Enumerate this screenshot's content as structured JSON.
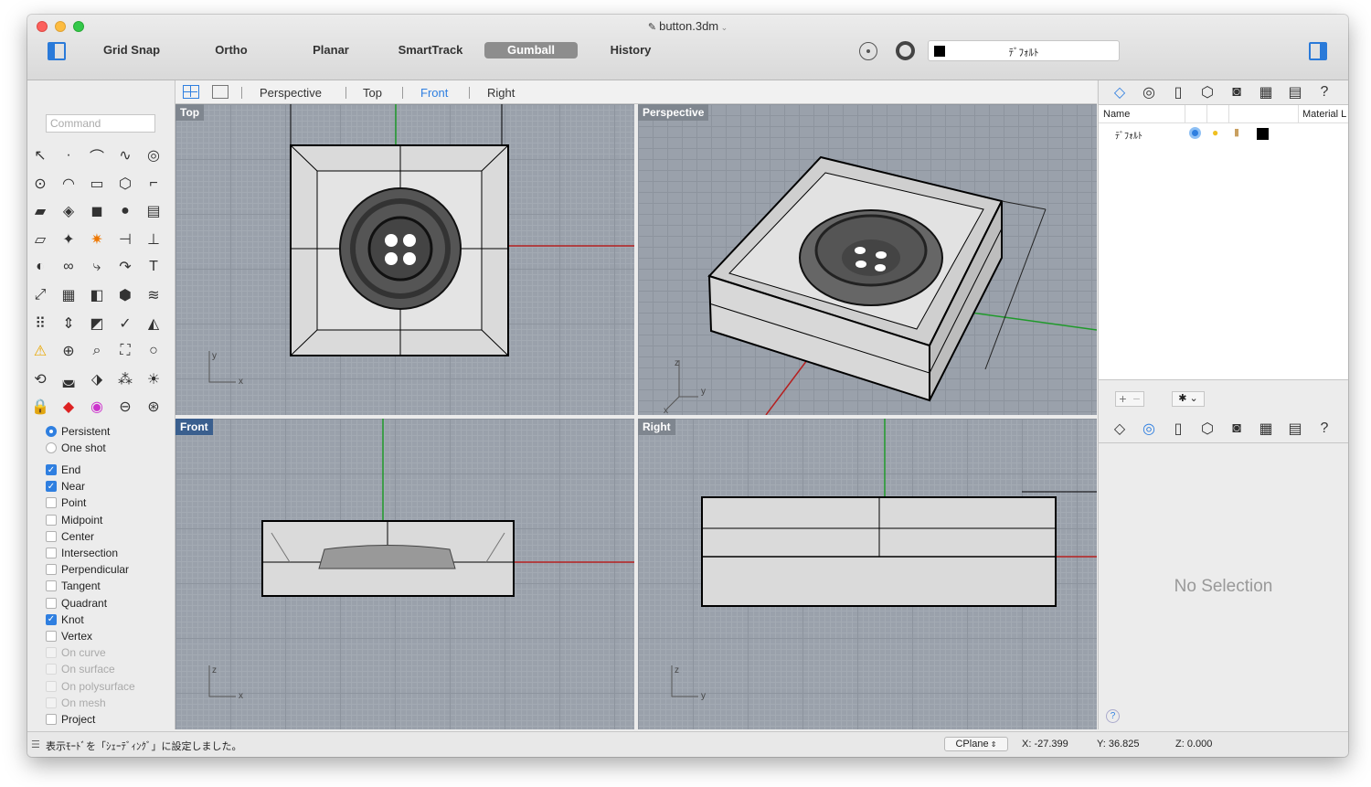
{
  "window": {
    "title": "button.3dm"
  },
  "toolbar": {
    "items": [
      "Grid Snap",
      "Ortho",
      "Planar",
      "SmartTrack",
      "Gumball",
      "History"
    ],
    "active": "Gumball",
    "layer": "ﾃﾞﾌｫﾙﾄ"
  },
  "tabs": {
    "items": [
      "Perspective",
      "Top",
      "Front",
      "Right"
    ],
    "active": "Front"
  },
  "command": {
    "placeholder": "Command"
  },
  "osnap": {
    "mode": [
      {
        "label": "Persistent",
        "on": true
      },
      {
        "label": "One shot",
        "on": false
      }
    ],
    "items": [
      {
        "label": "End",
        "checked": true,
        "disabled": false
      },
      {
        "label": "Near",
        "checked": true,
        "disabled": false
      },
      {
        "label": "Point",
        "checked": false,
        "disabled": false
      },
      {
        "label": "Midpoint",
        "checked": false,
        "disabled": false
      },
      {
        "label": "Center",
        "checked": false,
        "disabled": false
      },
      {
        "label": "Intersection",
        "checked": false,
        "disabled": false
      },
      {
        "label": "Perpendicular",
        "checked": false,
        "disabled": false
      },
      {
        "label": "Tangent",
        "checked": false,
        "disabled": false
      },
      {
        "label": "Quadrant",
        "checked": false,
        "disabled": false
      },
      {
        "label": "Knot",
        "checked": true,
        "disabled": false
      },
      {
        "label": "Vertex",
        "checked": false,
        "disabled": false
      },
      {
        "label": "On curve",
        "checked": false,
        "disabled": true
      },
      {
        "label": "On surface",
        "checked": false,
        "disabled": true
      },
      {
        "label": "On polysurface",
        "checked": false,
        "disabled": true
      },
      {
        "label": "On mesh",
        "checked": false,
        "disabled": true
      },
      {
        "label": "Project",
        "checked": false,
        "disabled": false
      }
    ]
  },
  "viewports": {
    "top": "Top",
    "perspective": "Perspective",
    "front": "Front",
    "right": "Right"
  },
  "layers": {
    "col_name": "Name",
    "col_material": "Material L",
    "rows": [
      {
        "name": "ﾃﾞﾌｫﾙﾄ"
      }
    ]
  },
  "properties": {
    "empty": "No Selection"
  },
  "status": {
    "message": "表示ﾓｰﾄﾞを「ｼｪｰﾃﾞｨﾝｸﾞ」に設定しました。",
    "cplane": "CPlane",
    "x": "X: -27.399",
    "y": "Y: 36.825",
    "z": "Z: 0.000"
  }
}
